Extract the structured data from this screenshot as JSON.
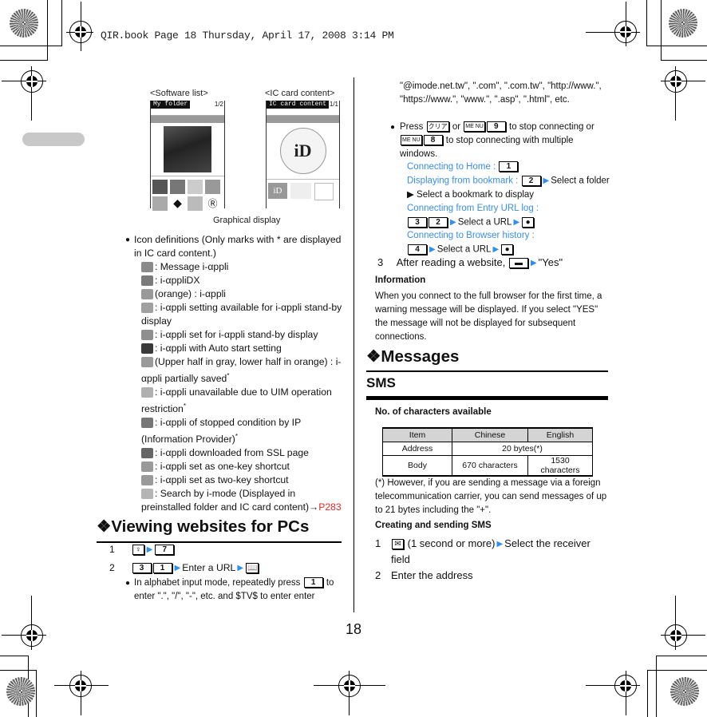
{
  "header": {
    "slug": "QIR.book  Page 18  Thursday, April 17, 2008  3:14 PM"
  },
  "page_number": "18",
  "screenshots": {
    "left": {
      "caption": "<Software list>",
      "title_bar": "My folder",
      "page": "1/2"
    },
    "right": {
      "caption": "<IC card content>",
      "title_bar": "IC card content",
      "page": "1/1"
    },
    "figure_caption": "Graphical display"
  },
  "icon_definitions": {
    "intro": "Icon definitions (Only marks with * are displayed in IC card content.)",
    "items": [
      {
        "icon": "message-iappli-icon",
        "color": "#8a8a8a",
        "text": ": Message i-αppli"
      },
      {
        "icon": "iapplidx-icon",
        "color": "#7a7a7a",
        "text": ": i-αppliDX"
      },
      {
        "icon": "iappli-orange-icon",
        "color": "#9a9a9a",
        "text": "(orange) : i-αppli"
      },
      {
        "icon": "standby-available-icon",
        "color": "#a0a0a0",
        "text": ": i-αppli setting available for i-αppli stand-by display"
      },
      {
        "icon": "standby-set-icon",
        "color": "#8f8f8f",
        "text": ": i-αppli set for i-αppli stand-by display"
      },
      {
        "icon": "auto-start-icon",
        "color": "#3a3a3a",
        "text": ": i-αppli with Auto start setting"
      },
      {
        "icon": "partially-saved-icon",
        "color": "#9a9a9a",
        "text": "(Upper half in gray, lower half in orange) : i-αppli partially saved",
        "star": "*"
      },
      {
        "icon": "uim-restricted-icon",
        "color": "#b0b0b0",
        "text": ": i-αppli unavailable due to UIM operation restriction",
        "star": "*"
      },
      {
        "icon": "stopped-by-ip-icon",
        "color": "#777777",
        "text": ": i-αppli of stopped condition by IP (Information Provider)",
        "star": "*"
      },
      {
        "icon": "ssl-icon",
        "color": "#666666",
        "text": ": i-αppli downloaded from SSL page"
      },
      {
        "icon": "one-key-shortcut-icon",
        "color": "#9a9a9a",
        "text": ": i-αppli set as one-key shortcut"
      },
      {
        "icon": "two-key-shortcut-icon",
        "color": "#9a9a9a",
        "text": ": i-αppli set as two-key shortcut"
      },
      {
        "icon": "search-by-imode-icon",
        "color": "#b5b5b5",
        "text": ": Search by i-mode (Displayed in preinstalled folder and IC card content)→",
        "link": "P283"
      }
    ]
  },
  "viewing_websites": {
    "heading": "❖Viewing websites for PCs",
    "step1": {
      "num": "1",
      "key": "7"
    },
    "step2": {
      "num": "2",
      "keys": [
        "3",
        "1"
      ],
      "text": "Enter a URL"
    },
    "bullet1": "In alphabet input mode, repeatedly press",
    "bullet1_key": "1",
    "bullet1_rest": "to enter \".\", \"/\", \"-\", etc. and $TV$ to enter  enter",
    "bullet1_cont": "\"@imode.net.tw\", \".com\", \".com.tw\", \"http://www.\", \"https://www.\", \"www.\", \".asp\", \".html\", etc.",
    "bullet2_a": "Press",
    "bullet2_clear": "クリア",
    "bullet2_or": "or",
    "bullet2_menu": "ME NU",
    "bullet2_key9": "9",
    "bullet2_b": "to stop connecting or",
    "bullet2_key8": "8",
    "bullet2_c": "to stop connecting with multiple windows.",
    "sub": [
      {
        "label": "Connecting to Home :",
        "keys": [
          "1"
        ],
        "rest": ""
      },
      {
        "label": "Displaying from bookmark :",
        "keys": [
          "2"
        ],
        "rest": "Select a folder ▶ Select a bookmark to display"
      },
      {
        "label": "Connecting from Entry URL log :",
        "keys": [
          "3",
          "2"
        ],
        "rest": "Select a URL"
      },
      {
        "label": "Connecting to Browser history :",
        "keys": [
          "4"
        ],
        "rest": "Select a URL"
      }
    ],
    "step3": {
      "num": "3",
      "text": "After reading a website,",
      "answer": "\"Yes\""
    },
    "info_title": "Information",
    "info_text": "When you connect to the full browser for the first time, a warning message will be displayed. If you select \"YES\" the message will not be displayed for subsequent connections."
  },
  "messages": {
    "heading": "❖Messages",
    "sms_heading": "SMS",
    "table_title": "No. of characters available",
    "table": {
      "headers": [
        "Item",
        "Chinese",
        "English"
      ],
      "rows": [
        [
          "Address",
          "20 bytes(*)"
        ],
        [
          "Body",
          "670 characters",
          "1530 characters"
        ]
      ]
    },
    "footnote": "(*) However, if you are sending a message via a foreign telecommunication carrier, you can send messages of up to 21 bytes including the \"+\".",
    "creating_title": "Creating and sending SMS",
    "step1": {
      "num": "1",
      "text": "(1 second or more)",
      "rest": "Select the receiver field"
    },
    "step2": {
      "num": "2",
      "text": "Enter the address"
    }
  },
  "colors": {
    "link_blue": "#3a8ee6",
    "arrow_blue": "#2f8ff0",
    "page_ref_red": "#e22222",
    "table_header_bg": "#d4d4d4"
  }
}
